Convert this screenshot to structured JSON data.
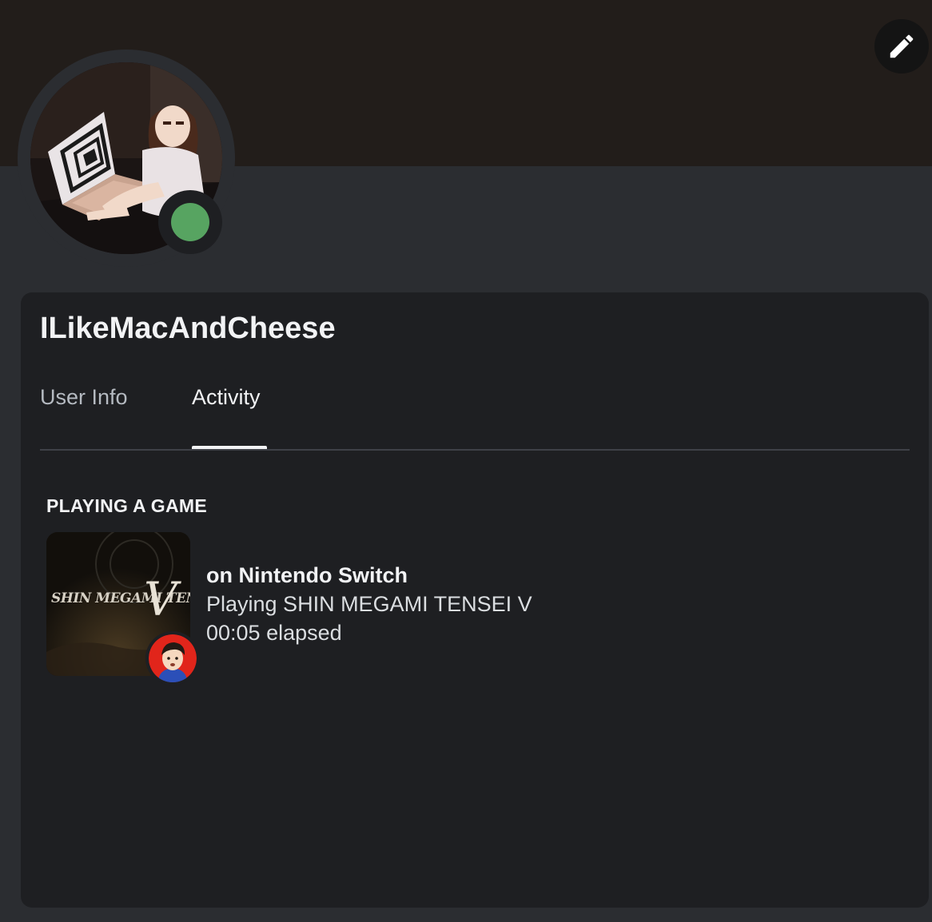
{
  "profile": {
    "username": "ILikeMacAndCheese",
    "status": "online",
    "status_color": "#57a461"
  },
  "actions": {
    "edit_icon": "pencil-icon"
  },
  "tabs": [
    {
      "label": "User Info",
      "active": false
    },
    {
      "label": "Activity",
      "active": true
    }
  ],
  "activity": {
    "section_title": "PLAYING A GAME",
    "platform": "on Nintendo Switch",
    "game": "Playing SHIN MEGAMI TENSEI V",
    "elapsed": "00:05 elapsed",
    "cover_text": "SHIN MEGAMI TENSEI",
    "cover_numeral": "V",
    "platform_icon": "mii-avatar-icon"
  }
}
